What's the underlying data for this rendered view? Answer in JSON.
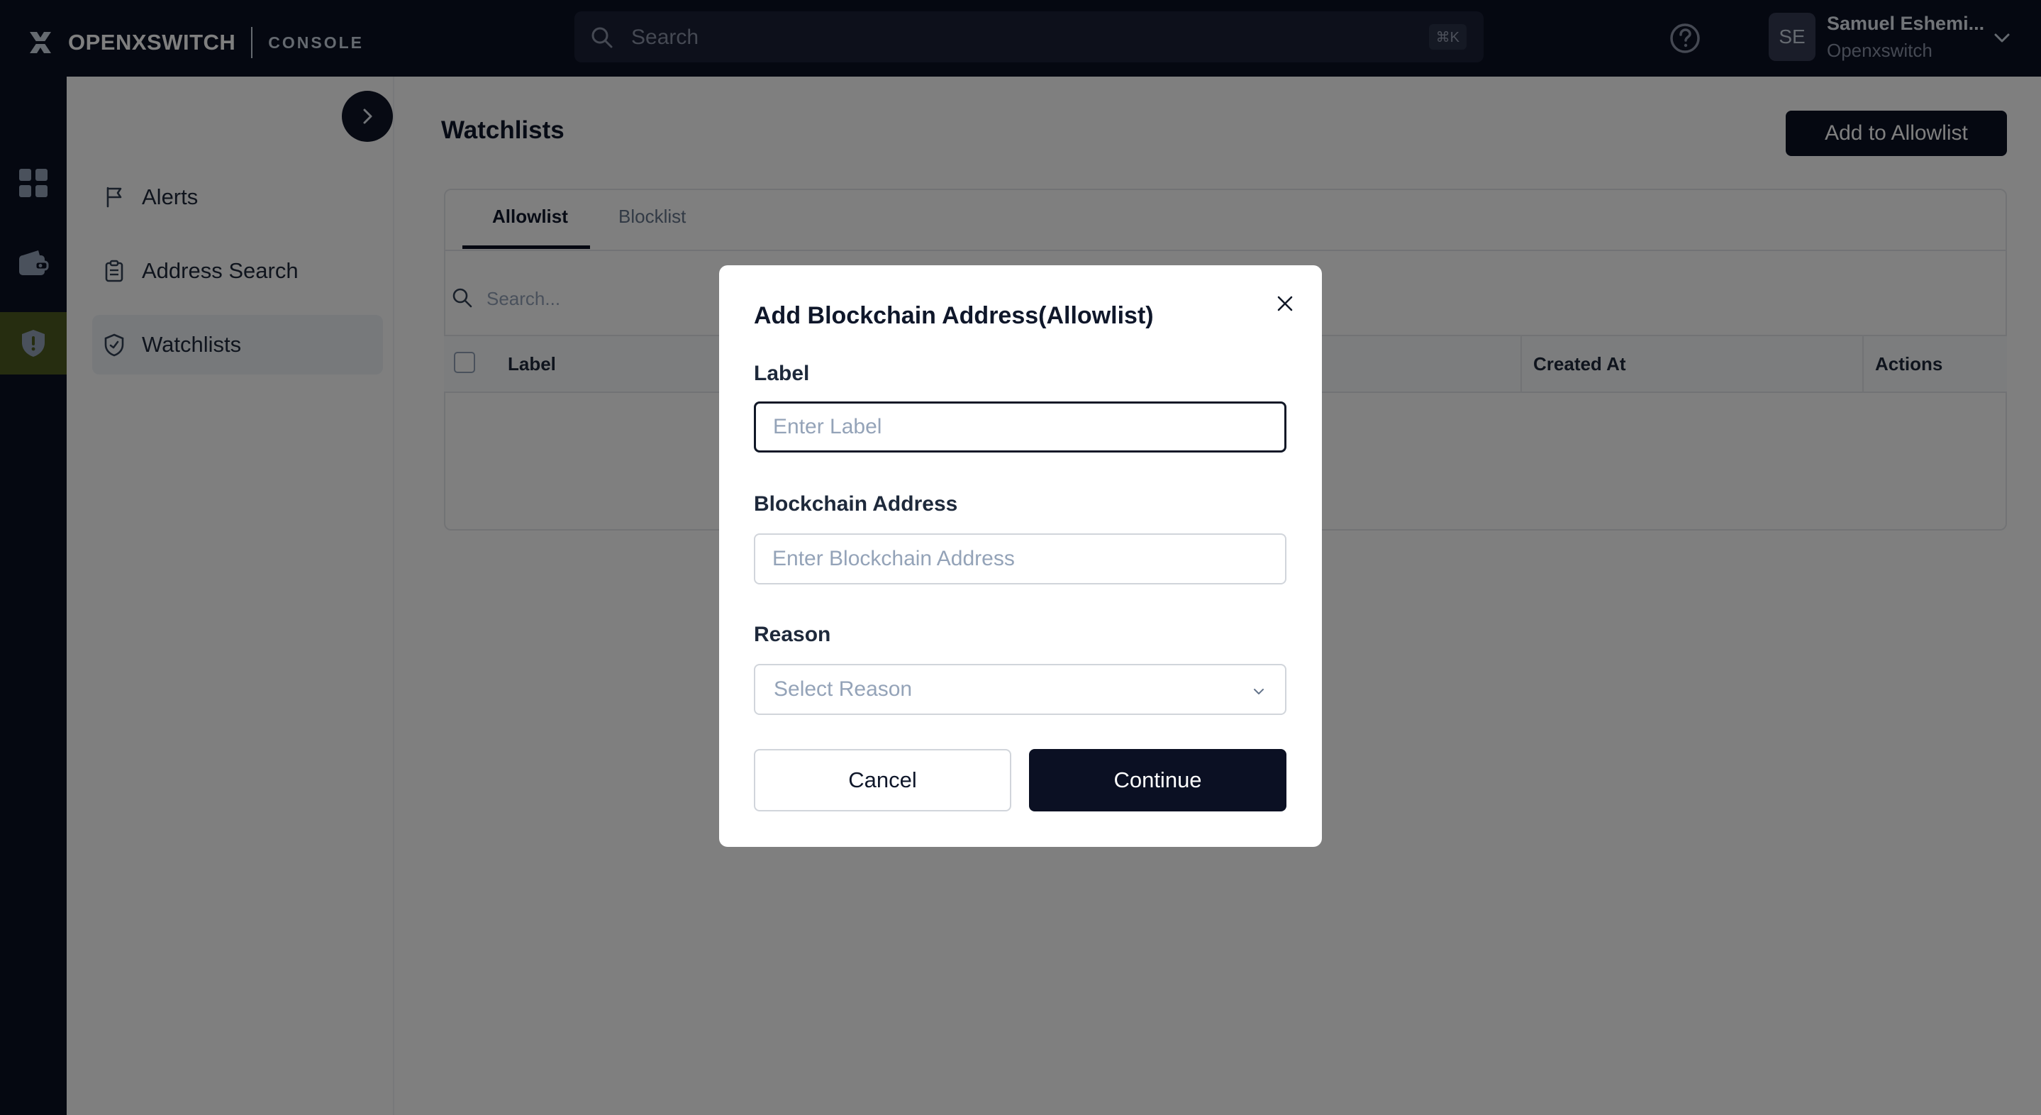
{
  "brand": {
    "name": "OPENXSWITCH",
    "product": "CONSOLE"
  },
  "topbar": {
    "search_placeholder": "Search",
    "search_shortcut": "⌘K",
    "help_icon": "help-circle-icon",
    "user": {
      "initials": "SE",
      "name": "Samuel Eshemi...",
      "org": "Openxswitch"
    }
  },
  "rail": [
    {
      "icon": "dashboard-grid-icon",
      "active": false
    },
    {
      "icon": "wallet-icon",
      "active": false
    },
    {
      "icon": "shield-icon",
      "active": true
    }
  ],
  "sidebar": {
    "items": [
      {
        "label": "Alerts",
        "icon": "flag-icon",
        "active": false
      },
      {
        "label": "Address Search",
        "icon": "clipboard-icon",
        "active": false
      },
      {
        "label": "Watchlists",
        "icon": "shield-check-icon",
        "active": true
      }
    ]
  },
  "main": {
    "title": "Watchlists",
    "primary_action": "Add to Allowlist",
    "tabs": [
      {
        "label": "Allowlist",
        "active": true
      },
      {
        "label": "Blocklist",
        "active": false
      }
    ],
    "table_search_placeholder": "Search...",
    "columns": [
      "Label",
      "Created At",
      "Actions"
    ]
  },
  "modal": {
    "title": "Add Blockchain Address(Allowlist)",
    "fields": {
      "label": {
        "label": "Label",
        "placeholder": "Enter Label",
        "value": ""
      },
      "address": {
        "label": "Blockchain Address",
        "placeholder": "Enter Blockchain Address",
        "value": ""
      },
      "reason": {
        "label": "Reason",
        "placeholder": "Select Reason"
      }
    },
    "cancel_label": "Cancel",
    "continue_label": "Continue"
  },
  "colors": {
    "navy": "#0b1023",
    "rail_active": "#4d5a20",
    "overlay": "rgba(0,0,0,0.5)"
  }
}
